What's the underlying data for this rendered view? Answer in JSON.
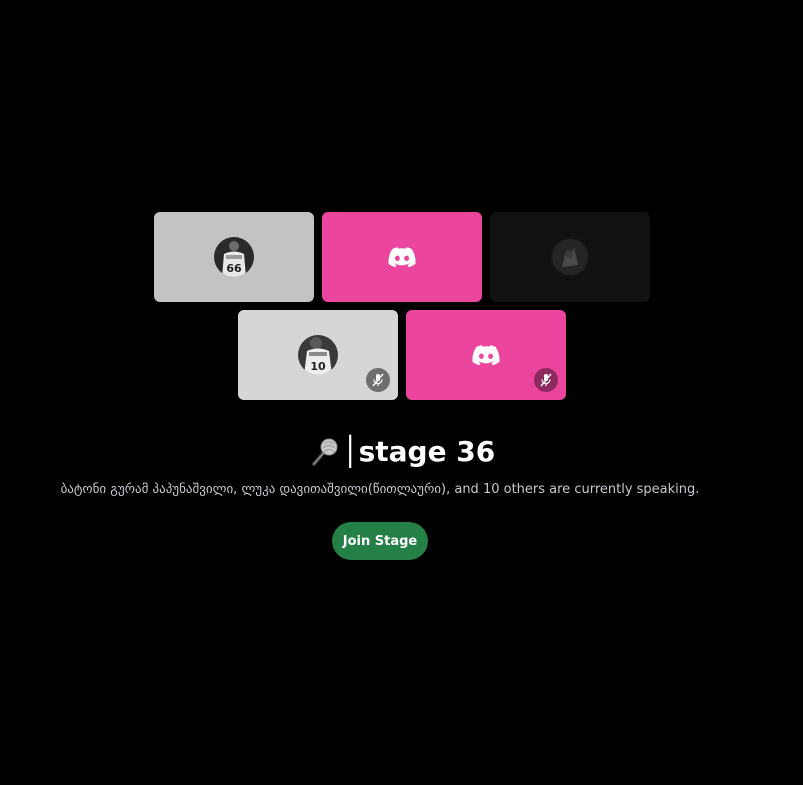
{
  "stage": {
    "title": "│stage 36",
    "title_icon": "microphone-icon",
    "speaking_text": "ბატონი გურამ პაპუნაშვილი, ლუკა დავითაშვილი(წითლაური), and 10 others are currently speaking.",
    "join_label": "Join Stage"
  },
  "participants": [
    {
      "kind": "avatar",
      "bg": "#c4c2c3",
      "jersey_number": "66",
      "muted": false
    },
    {
      "kind": "discord-default",
      "bg": "#eb459e",
      "muted": false
    },
    {
      "kind": "avatar",
      "bg": "#111111",
      "muted": false
    },
    {
      "kind": "avatar",
      "bg": "#d6d6d6",
      "jersey_number": "10",
      "muted": true
    },
    {
      "kind": "discord-default",
      "bg": "#eb459e",
      "muted": true
    }
  ],
  "colors": {
    "background": "#000000",
    "brand_pink": "#eb459e",
    "join_green": "#248046",
    "speaking_text": "#c6c8d2"
  }
}
